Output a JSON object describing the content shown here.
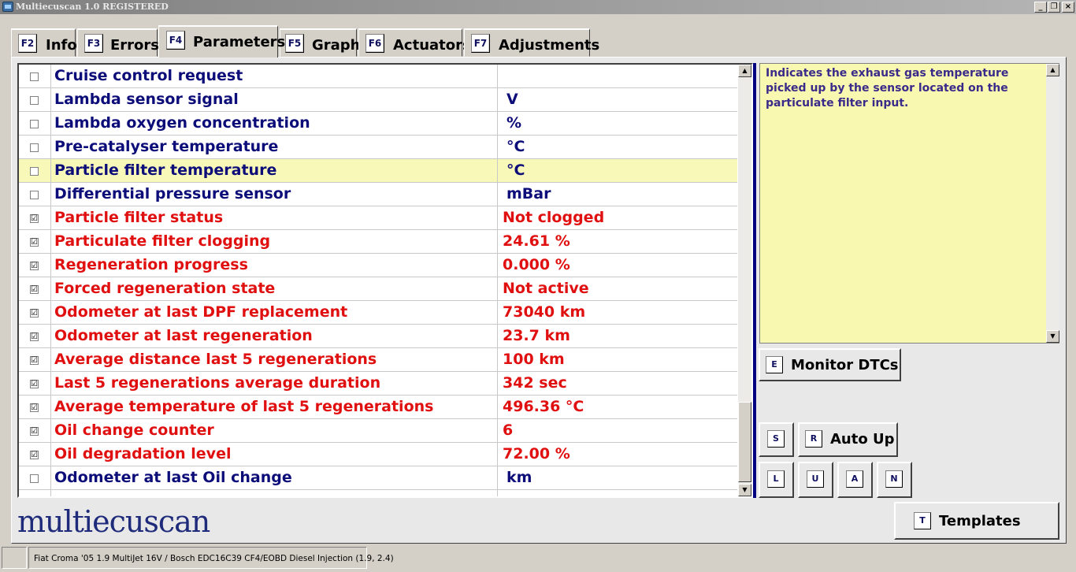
{
  "window": {
    "title": "Multiecuscan 1.0 REGISTERED",
    "controls": {
      "minimize": "_",
      "restore": "❐",
      "close": "×"
    }
  },
  "tabs": [
    {
      "key": "F2",
      "label": "Info"
    },
    {
      "key": "F3",
      "label": "Errors"
    },
    {
      "key": "F4",
      "label": "Parameters"
    },
    {
      "key": "F5",
      "label": "Graph"
    },
    {
      "key": "F6",
      "label": "Actuators"
    },
    {
      "key": "F7",
      "label": "Adjustments"
    }
  ],
  "active_tab": "Parameters",
  "parameters": [
    {
      "checked": false,
      "name": "Cruise control request",
      "value": ""
    },
    {
      "checked": false,
      "name": "Lambda sensor signal",
      "value": "V"
    },
    {
      "checked": false,
      "name": "Lambda oxygen concentration",
      "value": "%"
    },
    {
      "checked": false,
      "name": "Pre-catalyser temperature",
      "value": "°C"
    },
    {
      "checked": false,
      "name": "Particle filter temperature",
      "value": "°C",
      "selected": true
    },
    {
      "checked": false,
      "name": "Differential pressure sensor",
      "value": "mBar"
    },
    {
      "checked": true,
      "name": "Particle filter status",
      "value": "Not clogged"
    },
    {
      "checked": true,
      "name": "Particulate filter clogging",
      "value": "24.61 %"
    },
    {
      "checked": true,
      "name": "Regeneration progress",
      "value": "0.000 %"
    },
    {
      "checked": true,
      "name": "Forced regeneration state",
      "value": "Not active"
    },
    {
      "checked": true,
      "name": "Odometer at last DPF replacement",
      "value": "73040 km"
    },
    {
      "checked": true,
      "name": "Odometer at last regeneration",
      "value": "23.7 km"
    },
    {
      "checked": true,
      "name": "Average distance last 5 regenerations",
      "value": "100 km"
    },
    {
      "checked": true,
      "name": "Last 5 regenerations average duration",
      "value": "342 sec"
    },
    {
      "checked": true,
      "name": "Average temperature of last 5 regenerations",
      "value": "496.36 °C"
    },
    {
      "checked": true,
      "name": "Oil change counter",
      "value": "6"
    },
    {
      "checked": true,
      "name": "Oil degradation level",
      "value": "72.00 %"
    },
    {
      "checked": false,
      "name": "Odometer at last Oil change",
      "value": "km"
    }
  ],
  "description": "Indicates the exhaust gas temperature picked up by the sensor located on the particulate filter input.",
  "buttons": {
    "monitor_dtcs": {
      "key": "E",
      "label": "Monitor DTCs"
    },
    "s": {
      "key": "S"
    },
    "auto_up": {
      "key": "R",
      "label": "Auto Up"
    },
    "l": {
      "key": "L"
    },
    "u": {
      "key": "U"
    },
    "a": {
      "key": "A"
    },
    "n": {
      "key": "N"
    },
    "templates": {
      "key": "T",
      "label": "Templates"
    }
  },
  "logo": "multiecuscan",
  "status": {
    "vehicle": "Fiat Croma '05 1.9 MultiJet 16V / Bosch EDC16C39 CF4/EOBD Diesel Injection (1.9, 2.4)"
  },
  "icons": {
    "checkbox_checked": "☑",
    "scroll_up": "▲",
    "scroll_down": "▼"
  },
  "colors": {
    "active_param": "#e01010",
    "inactive_param": "#0d0d7a",
    "selected_row": "#f8f8b8",
    "description_bg": "#f8f8b0",
    "divider": "#000080"
  }
}
